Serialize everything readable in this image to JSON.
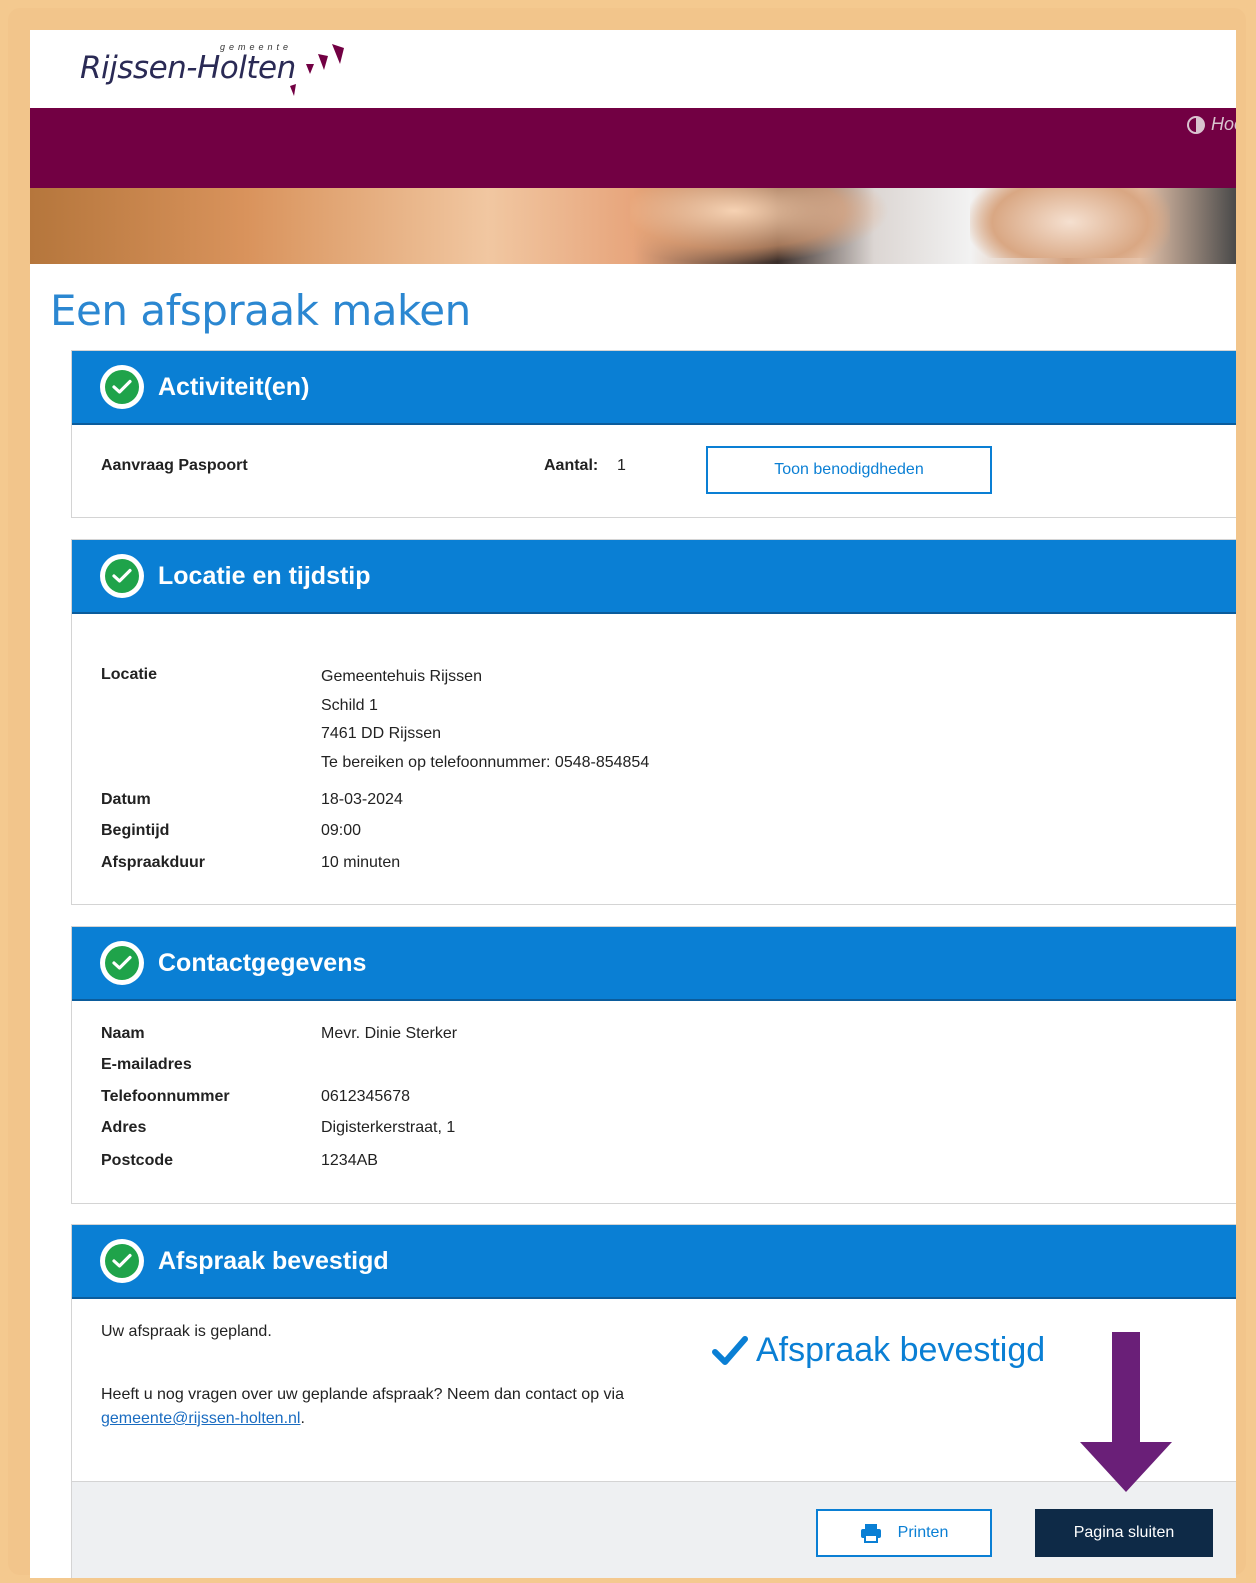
{
  "header": {
    "logo_small": "gemeente",
    "logo_text": "Rijssen-Holten",
    "contrast_label": "Hoo"
  },
  "page_title": "Een afspraak maken",
  "activities": {
    "title": "Activiteit(en)",
    "item_name": "Aanvraag Paspoort",
    "count_label": "Aantal:",
    "count_value": "1",
    "requirements_button": "Toon benodigdheden"
  },
  "location": {
    "title": "Locatie en tijdstip",
    "location_label": "Locatie",
    "location_lines": [
      "Gemeentehuis Rijssen",
      "Schild 1",
      "7461 DD Rijssen",
      "Te bereiken op telefoonnummer: 0548-854854"
    ],
    "date_label": "Datum",
    "date_value": "18-03-2024",
    "start_label": "Begintijd",
    "start_value": "09:00",
    "duration_label": "Afspraakduur",
    "duration_value": "10 minuten"
  },
  "contact": {
    "title": "Contactgegevens",
    "fields": [
      {
        "label": "Naam",
        "value": "Mevr. Dinie Sterker"
      },
      {
        "label": "E-mailadres",
        "value": ""
      },
      {
        "label": "Telefoonnummer",
        "value": "0612345678"
      },
      {
        "label": "Adres",
        "value": "Digisterkerstraat, 1"
      },
      {
        "label": "Postcode",
        "value": "1234AB"
      }
    ]
  },
  "confirmation": {
    "title": "Afspraak bevestigd",
    "planned_text": "Uw afspraak is gepland.",
    "question_text": "Heeft u nog vragen over uw geplande afspraak? Neem dan contact op via",
    "email_link": "gemeente@rijssen-holten.nl",
    "period": ".",
    "confirmed_badge": "Afspraak bevestigd",
    "print_button": "Printen",
    "close_button": "Pagina sluiten"
  },
  "colors": {
    "primary_blue": "#0a7fd4",
    "nav_purple": "#720043",
    "success_green": "#1fa34a",
    "dark_button": "#0e2a47",
    "annotation_arrow": "#6a1f78"
  },
  "icons": [
    "contrast-icon",
    "check-circle-icon",
    "checkmark-icon",
    "printer-icon",
    "arrow-down-icon"
  ]
}
